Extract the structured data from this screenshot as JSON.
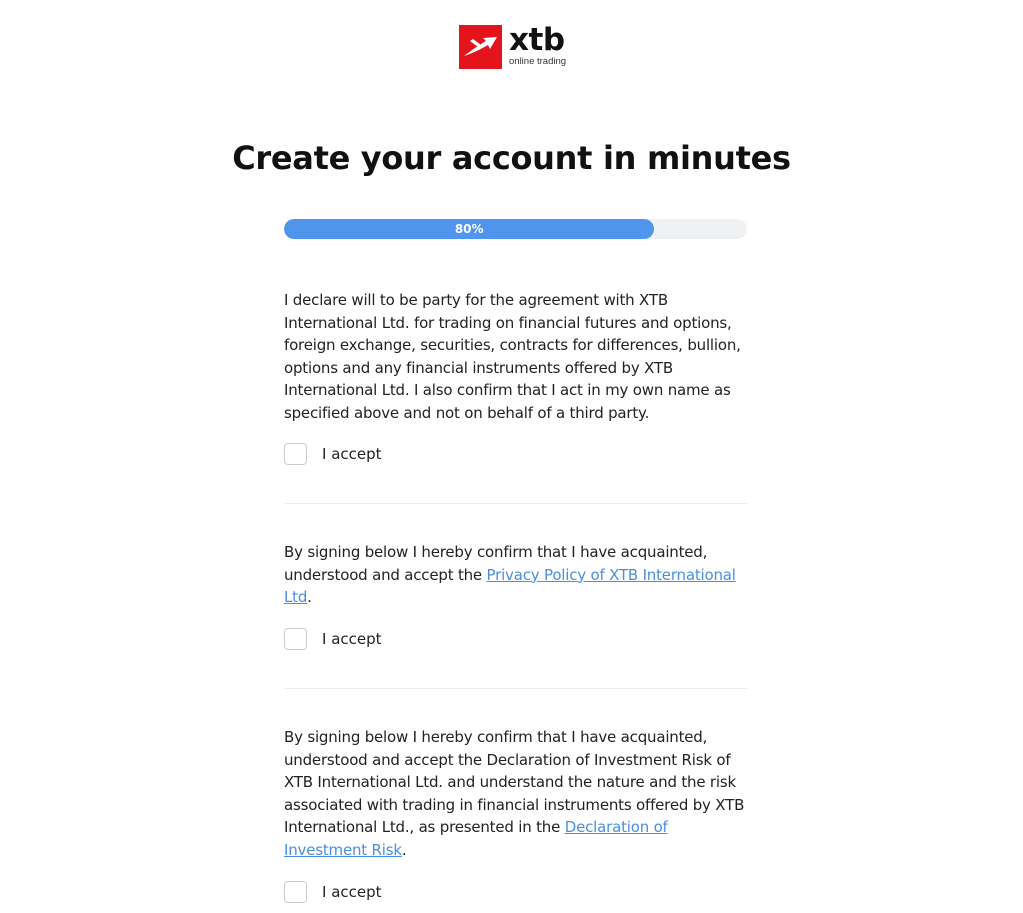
{
  "brand": {
    "name": "xtb",
    "tagline": "online trading",
    "logo_icon": "xtb-logo-icon",
    "accent_color": "#e3141b"
  },
  "page_title": "Create your account in minutes",
  "progress": {
    "percent": 80,
    "label": "80%",
    "fill_color": "#4f95ed"
  },
  "sections": [
    {
      "text": "I declare will to be party for the agreement with XTB International Ltd. for trading on financial futures and options, foreign exchange, securities, contracts for differences, bullion, options and any financial instruments offered by XTB International Ltd. I also confirm that I act in my own name as specified above and not on behalf of a third party.",
      "accept_label": "I accept",
      "checked": false
    },
    {
      "text_before": "By signing below I hereby confirm that I have acquainted, understood and accept the ",
      "link_text": "Privacy Policy of XTB International Ltd",
      "text_after": ".",
      "accept_label": "I accept",
      "checked": false
    },
    {
      "text_before": "By signing below I hereby confirm that I have acquainted, understood and accept the Declaration of Investment Risk of XTB International Ltd. and understand the nature and the risk associated with trading in financial instruments offered by XTB International Ltd., as presented in the ",
      "link_text": "Declaration of Investment Risk",
      "text_after": ".",
      "accept_label": "I accept",
      "checked": false
    }
  ]
}
